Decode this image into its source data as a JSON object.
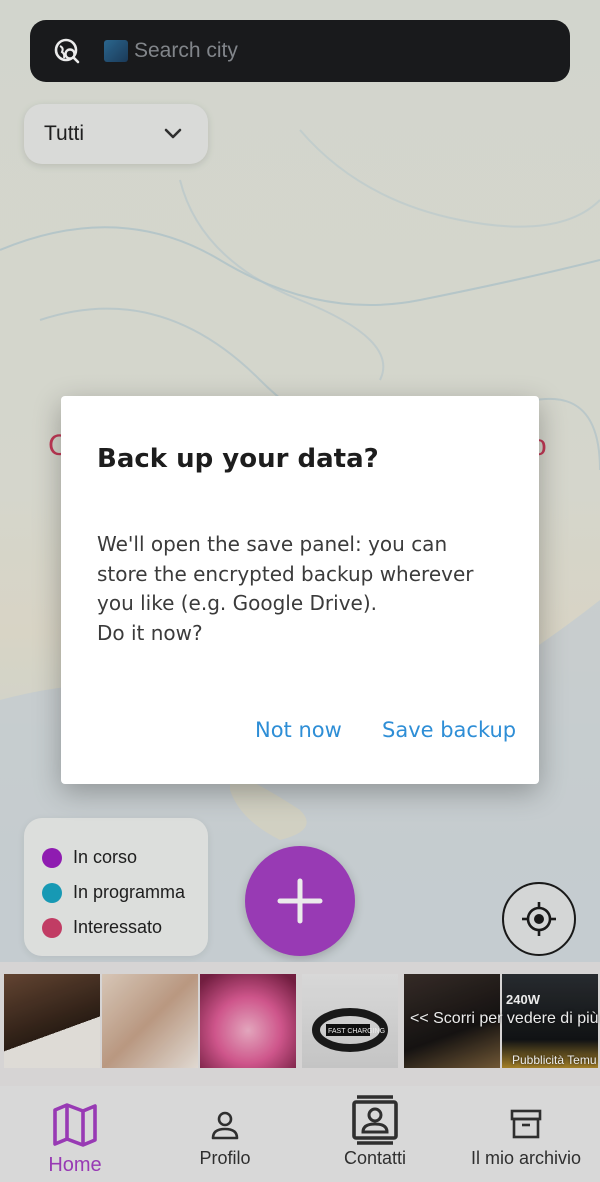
{
  "search": {
    "placeholder": "Search city",
    "icon": "travel-explore-icon"
  },
  "filter": {
    "selected": "Tutti",
    "icon": "chevron-down-icon"
  },
  "legend": {
    "items": [
      {
        "label": "In corso",
        "color": "#9c1fc0"
      },
      {
        "label": "In programma",
        "color": "#1aa6c4"
      },
      {
        "label": "Interessato",
        "color": "#d2426d"
      }
    ]
  },
  "fab": {
    "icon": "plus-icon",
    "color": "#a53fc4"
  },
  "locate": {
    "icon": "my-location-icon"
  },
  "ads": {
    "hint": "<< Scorri per vedere di più",
    "badge": "Pubblicità Temu",
    "tiles": [
      {
        "icon": "ad-image-nails"
      },
      {
        "icon": "ad-image-nail-set"
      },
      {
        "icon": "ad-image-lip-gloss"
      },
      {
        "icon": "ad-image-charging-cable",
        "text": "FAST CHARGING"
      },
      {
        "icon": "ad-image-power-bank"
      },
      {
        "icon": "ad-image-asus-charger",
        "text": "240W"
      }
    ]
  },
  "nav": {
    "items": [
      {
        "label": "Home",
        "icon": "map-icon",
        "active": true
      },
      {
        "label": "Profilo",
        "icon": "person-icon"
      },
      {
        "label": "Contatti",
        "icon": "contacts-icon"
      },
      {
        "label": "Il mio archivio",
        "icon": "archive-icon"
      }
    ]
  },
  "dialog": {
    "title": "Back up your data?",
    "body_lines": [
      "We'll open the save panel: you can",
      "store the encrypted backup wherever",
      "you like (e.g. Google Drive).",
      "Do it now?"
    ],
    "negative": "Not now",
    "positive": "Save backup"
  },
  "colors": {
    "accent": "#a53fc4",
    "dialog_button": "#2e8ed6"
  }
}
